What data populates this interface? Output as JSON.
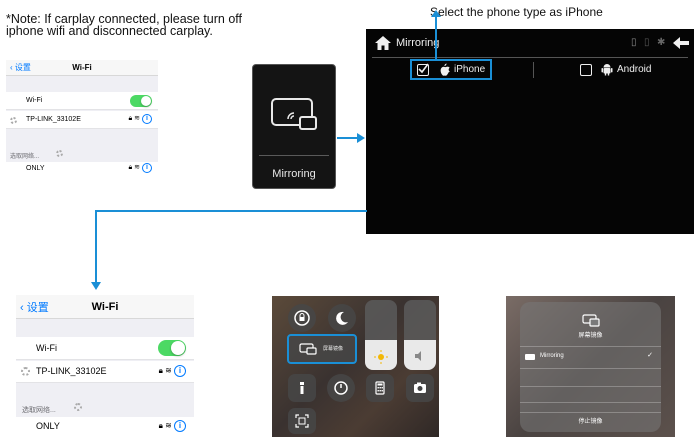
{
  "note": "*Note: If carplay connected, please turn off iphone wifi and disconnected carplay.",
  "phone_type_label": "Select the phone type as iPhone",
  "wifi_small": {
    "back": "设置",
    "title": "Wi-Fi",
    "wifi_label": "Wi-Fi",
    "network": "TP-LINK_33102E",
    "choose_network": "选取网络...",
    "other": "ONLY"
  },
  "wifi_large": {
    "back": "设置",
    "title": "Wi-Fi",
    "wifi_label": "Wi-Fi",
    "network": "TP-LINK_33102E",
    "choose_network": "选取网络...",
    "other": "ONLY"
  },
  "tile": {
    "label": "Mirroring"
  },
  "car": {
    "title": "Mirroring",
    "option_iphone": "iPhone",
    "option_android": "Android",
    "iphone_checked": true,
    "android_checked": false
  },
  "control_center": {
    "mirror_label": "屏幕镜像"
  },
  "mirror_popup": {
    "title": "屏幕镜像",
    "device": "Mirroring",
    "stop": "停止镜像"
  },
  "colors": {
    "accent": "#1a8fd6",
    "ios_blue": "#007aff",
    "toggle_green": "#4cd964"
  }
}
